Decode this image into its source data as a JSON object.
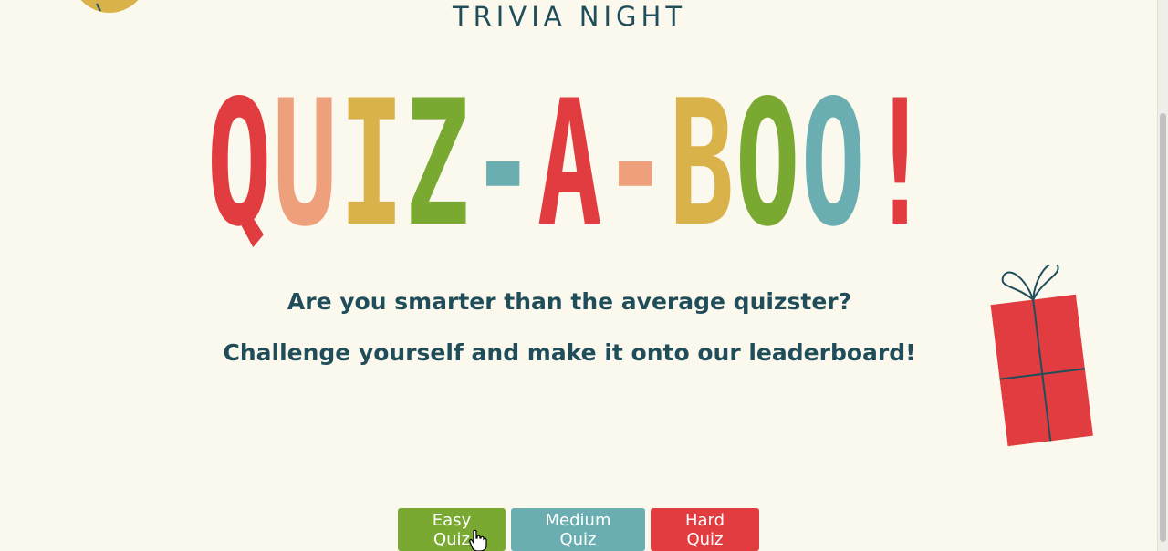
{
  "header": {
    "eyebrow": "TRIVIA NIGHT"
  },
  "hero": {
    "letters": [
      {
        "char": "Q",
        "color": "#e13c3f"
      },
      {
        "char": "U",
        "color": "#eea07c"
      },
      {
        "char": "I",
        "color": "#d9b24a"
      },
      {
        "char": "Z",
        "color": "#7aa932"
      },
      {
        "char": "-",
        "color": "#6aaeb1"
      },
      {
        "char": "A",
        "color": "#e13c3f"
      },
      {
        "char": "-",
        "color": "#eea07c"
      },
      {
        "char": "B",
        "color": "#d9b24a"
      },
      {
        "char": "O",
        "color": "#7aa932"
      },
      {
        "char": "O",
        "color": "#6aaeb1"
      },
      {
        "char": "!",
        "color": "#e13c3f"
      }
    ]
  },
  "intro": {
    "line1": "Are you smarter than the average quizster?",
    "line2": "Challenge yourself and make it onto our leaderboard!"
  },
  "buttons": {
    "easy": {
      "label": "Easy Quiz",
      "color": "#7aa932"
    },
    "medium": {
      "label": "Medium Quiz",
      "color": "#6aaeb1"
    },
    "hard": {
      "label": "Hard Quiz",
      "color": "#e13c3f"
    }
  },
  "decorations": {
    "ornament_icon": "ornament-icon",
    "gift_icon": "gift-box-icon",
    "cursor_icon": "hand-pointer-icon"
  }
}
